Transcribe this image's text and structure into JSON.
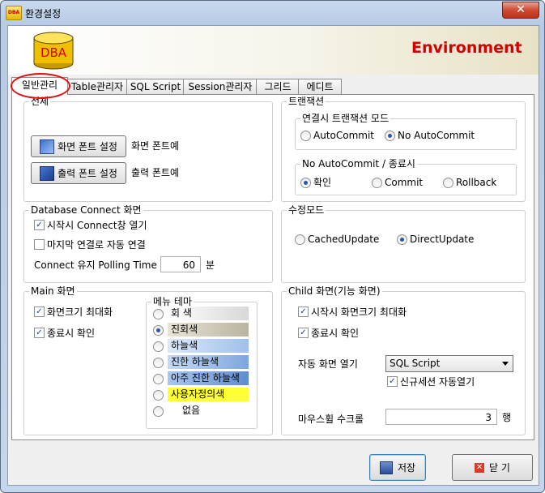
{
  "window": {
    "title": "환경설정",
    "close_glyph": "✕"
  },
  "banner": {
    "logo_text": "DBA",
    "title": "Environment"
  },
  "tabs": [
    {
      "label": "일반관리"
    },
    {
      "label": "Table관리자"
    },
    {
      "label": "SQL Script"
    },
    {
      "label": "Session관리자"
    },
    {
      "label": "그리드"
    },
    {
      "label": "에디트"
    }
  ],
  "general": {
    "title": "전체",
    "screen_font_button": "화면 폰트 설정",
    "screen_font_sample": "화면 폰트예",
    "print_font_button": "출력 폰트 설정",
    "print_font_sample": "출력 폰트예"
  },
  "transaction": {
    "title": "트랜잭션",
    "connect_mode": {
      "title": "연결시 트랜잭션 모드",
      "options": [
        "AutoCommit",
        "No AutoCommit"
      ],
      "selected": "No AutoCommit"
    },
    "exit_mode": {
      "title": "No AutoCommit / 종료시",
      "options": [
        "확인",
        "Commit",
        "Rollback"
      ],
      "selected": "확인"
    }
  },
  "db_connect": {
    "title": "Database Connect 화면",
    "open_on_start": {
      "label": "시작시 Connect창 열기",
      "checked": true
    },
    "auto_reconnect": {
      "label": "마지막 연결로 자동 연결",
      "checked": false
    },
    "polling_label": "Connect 유지 Polling Time",
    "polling_value": "60",
    "polling_unit": "분"
  },
  "edit_mode": {
    "title": "수정모드",
    "options": [
      "CachedUpdate",
      "DirectUpdate"
    ],
    "selected": "DirectUpdate"
  },
  "main_screen": {
    "title": "Main 화면",
    "maximize": {
      "label": "화면크기 최대화",
      "checked": true
    },
    "confirm_exit": {
      "label": "종료시 확인",
      "checked": true
    },
    "menu_theme": {
      "title": "메뉴 테마",
      "selected": "진회색",
      "items": [
        {
          "label": "회  색",
          "bg": "linear-gradient(90deg,#ffffff,#d8d8d8)"
        },
        {
          "label": "진회색",
          "bg": "linear-gradient(90deg,#e8e4d6,#b9b4a0)"
        },
        {
          "label": "하늘색",
          "bg": "linear-gradient(90deg,#dce9fa,#9fc0ea)"
        },
        {
          "label": "진한 하늘색",
          "bg": "linear-gradient(90deg,#c6daf5,#7ea6de)"
        },
        {
          "label": "아주 진한 하늘색",
          "bg": "linear-gradient(90deg,#a9c6ef,#5e8ccf)"
        },
        {
          "label": "사용자정의색",
          "bg": "#ffff33"
        },
        {
          "label": "없음",
          "bg": "transparent"
        }
      ]
    }
  },
  "child_screen": {
    "title": "Child 화면(기능 화면)",
    "maximize": {
      "label": "시작시 화면크기 최대화",
      "checked": true
    },
    "confirm_exit": {
      "label": "종료시 확인",
      "checked": true
    },
    "auto_open_label": "자동 화면 열기",
    "auto_open_value": "SQL Script",
    "new_session": {
      "label": "신규세션 자동열기",
      "checked": true
    },
    "wheel_label": "마우스휠 수크롤",
    "wheel_value": "3",
    "wheel_unit": "행"
  },
  "footer": {
    "save_label": "저장",
    "close_label": "닫 기"
  },
  "colors": {
    "accent_red": "#d40000",
    "selection_blue": "#2a55b5"
  }
}
